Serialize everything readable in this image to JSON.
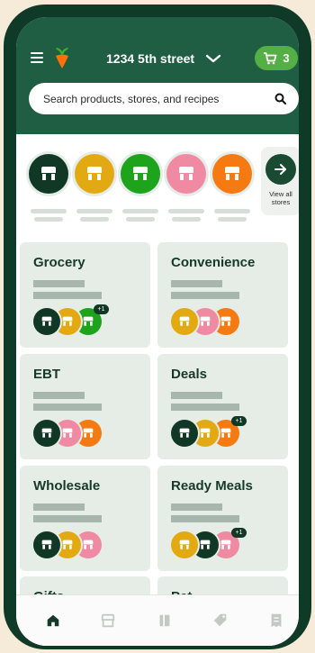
{
  "colors": {
    "brand_dark": "#0e3a27",
    "header_green": "#1f5e43",
    "cart_green": "#54b045",
    "card_bg": "#e6ede6",
    "store_colors": [
      "#103824",
      "#e3a913",
      "#1da31c",
      "#f08aa3",
      "#f57a12"
    ]
  },
  "header": {
    "address": "1234 5th street",
    "cart_count": "3",
    "icons": [
      "menu-icon",
      "carrot-logo-icon",
      "chevron-down-icon",
      "cart-icon"
    ]
  },
  "search": {
    "placeholder": "Search products, stores, and recipes",
    "icon": "search-icon"
  },
  "stores": {
    "view_all_label": "View all stores",
    "items": [
      {
        "color": "#103824"
      },
      {
        "color": "#e3a913"
      },
      {
        "color": "#1da31c"
      },
      {
        "color": "#f08aa3"
      },
      {
        "color": "#f57a12"
      }
    ]
  },
  "categories": [
    {
      "title": "Grocery",
      "avatars": [
        "#103824",
        "#e3a913",
        "#1da31c"
      ],
      "extra": "+1"
    },
    {
      "title": "Convenience",
      "avatars": [
        "#e3a913",
        "#f08aa3",
        "#f57a12"
      ],
      "extra": ""
    },
    {
      "title": "EBT",
      "avatars": [
        "#103824",
        "#f08aa3",
        "#f57a12"
      ],
      "extra": ""
    },
    {
      "title": "Deals",
      "avatars": [
        "#103824",
        "#e3a913",
        "#f57a12"
      ],
      "extra": "+1"
    },
    {
      "title": "Wholesale",
      "avatars": [
        "#103824",
        "#e3a913",
        "#f08aa3"
      ],
      "extra": ""
    },
    {
      "title": "Ready Meals",
      "avatars": [
        "#e3a913",
        "#103824",
        "#f08aa3"
      ],
      "extra": "+1"
    },
    {
      "title": "Gifts",
      "avatars": [],
      "extra": ""
    },
    {
      "title": "Pet",
      "avatars": [],
      "extra": ""
    }
  ],
  "tabbar": {
    "items": [
      "home-icon",
      "stores-icon",
      "recipes-book-icon",
      "deals-tag-icon",
      "orders-receipt-icon"
    ]
  }
}
